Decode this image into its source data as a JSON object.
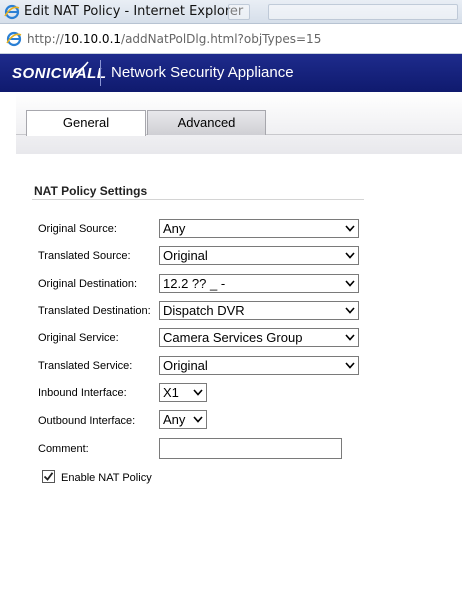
{
  "window": {
    "title": "Edit NAT Policy - Internet Explorer",
    "url_prefix": "http://",
    "url_host": "10.10.0.1",
    "url_path": "/addNatPolDlg.html?objTypes=15"
  },
  "brand": {
    "logo_text": "SONICWALL",
    "product": "Network Security Appliance"
  },
  "tabs": [
    {
      "label": "General",
      "active": true
    },
    {
      "label": "Advanced",
      "active": false
    }
  ],
  "section": {
    "title": "NAT Policy Settings"
  },
  "fields": {
    "original_source": {
      "label": "Original Source:",
      "value": "Any"
    },
    "translated_source": {
      "label": "Translated Source:",
      "value": "Original"
    },
    "original_destination": {
      "label": "Original Destination:",
      "value": "12.2 ?? _ -"
    },
    "translated_destination": {
      "label": "Translated Destination:",
      "value": "Dispatch DVR"
    },
    "original_service": {
      "label": "Original Service:",
      "value": "Camera Services Group"
    },
    "translated_service": {
      "label": "Translated Service:",
      "value": "Original"
    },
    "inbound_interface": {
      "label": "Inbound Interface:",
      "value": "X1"
    },
    "outbound_interface": {
      "label": "Outbound Interface:",
      "value": "Any"
    },
    "comment": {
      "label": "Comment:",
      "value": ""
    }
  },
  "enable_nat": {
    "label": "Enable NAT Policy",
    "checked": true
  },
  "colors": {
    "brand_blue": "#1e2b8c",
    "tab_border": "#a7a7ad"
  }
}
